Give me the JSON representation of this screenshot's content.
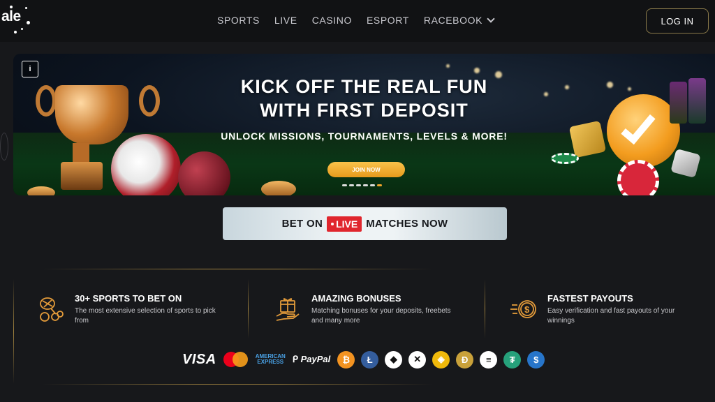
{
  "header": {
    "logo_text": "ale",
    "nav": [
      {
        "label": "SPORTS"
      },
      {
        "label": "LIVE"
      },
      {
        "label": "CASINO"
      },
      {
        "label": "ESPORT"
      },
      {
        "label": "RACEBOOK"
      }
    ],
    "login_label": "LOG IN"
  },
  "banner": {
    "title_line1": "KICK OFF THE REAL FUN",
    "title_line2": "WITH FIRST DEPOSIT",
    "subtitle": "UNLOCK MISSIONS, TOURNAMENTS, LEVELS & MORE!",
    "cta_label": "JOIN NOW",
    "info_label": "i",
    "slides_count": 6,
    "active_slide": 5
  },
  "live_banner": {
    "prefix": "BET ON",
    "badge": "LIVE",
    "suffix": "MATCHES NOW"
  },
  "features": [
    {
      "icon": "sports-icon",
      "title": "30+ SPORTS TO BET ON",
      "description": "The most extensive selection of sports to pick from"
    },
    {
      "icon": "gift-icon",
      "title": "AMAZING BONUSES",
      "description": "Matching bonuses for your deposits, freebets and many more"
    },
    {
      "icon": "fast-payout-icon",
      "title": "FASTEST PAYOUTS",
      "description": "Easy verification and fast payouts of your winnings"
    }
  ],
  "payments": {
    "visa": "VISA",
    "amex_line1": "AMERICAN",
    "amex_line2": "EXPRESS",
    "paypal": "PayPal",
    "coins": [
      {
        "name": "bitcoin-icon",
        "symbol": "₿",
        "color": "#f39321"
      },
      {
        "name": "litecoin-icon",
        "symbol": "Ł",
        "color": "#345d9d"
      },
      {
        "name": "ethereum-icon",
        "symbol": "◆",
        "color": "#ffffff"
      },
      {
        "name": "xrp-icon",
        "symbol": "✕",
        "color": "#ffffff"
      },
      {
        "name": "bnb-icon",
        "symbol": "◈",
        "color": "#f0b90b"
      },
      {
        "name": "dogecoin-icon",
        "symbol": "Ð",
        "color": "#c9a13a"
      },
      {
        "name": "solana-icon",
        "symbol": "≡",
        "color": "#ffffff"
      },
      {
        "name": "tether-icon",
        "symbol": "₮",
        "color": "#26a17b"
      },
      {
        "name": "usdc-icon",
        "symbol": "$",
        "color": "#2775ca"
      }
    ]
  },
  "colors": {
    "accent_gold": "#a0823f",
    "cta_orange": "#f2a52a",
    "live_red": "#e0262d",
    "background": "#17181b"
  }
}
